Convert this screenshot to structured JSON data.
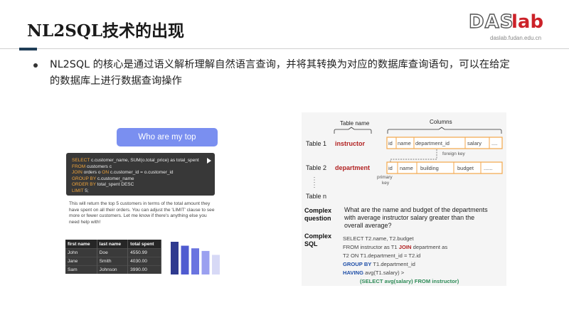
{
  "header": {
    "title": "NL2SQL技术的出现",
    "logo_das": "DAS",
    "logo_lab": "lab",
    "logo_url": "daslab.fudan.edu.cn"
  },
  "bullet": {
    "text": "NL2SQL 的核心是通过语义解析理解自然语言查询，并将其转换为对应的数据库查询语句，可以在给定的数据库上进行数据查询操作"
  },
  "chat": {
    "question": "Who are my top customers?",
    "sql_lines": [
      {
        "kw": "SELECT",
        "rest": " c.customer_name, SUM(o.total_price) as total_spent"
      },
      {
        "kw": "FROM",
        "rest": " customers c"
      },
      {
        "kw": "JOIN",
        "rest": " orders o ",
        "kw2": "ON",
        "rest2": " c.customer_id = o.customer_id"
      },
      {
        "kw": "GROUP BY",
        "rest": " c.customer_name"
      },
      {
        "kw": "ORDER BY",
        "rest": " total_spent DESC"
      },
      {
        "kw": "LIMIT",
        "rest": " 5;"
      }
    ],
    "answer": "This will return the top 5 customers in terms of the total amount they have spent on all their orders. You can adjust the 'LIMIT' clause to see more or fewer customers. Let me know if there's anything else you need help with!",
    "table": {
      "headers": [
        "first name",
        "last name",
        "total spent"
      ],
      "rows": [
        [
          "John",
          "Doe",
          "4550.99"
        ],
        [
          "Jane",
          "Smith",
          "4030.00"
        ],
        [
          "Sam",
          "Johnson",
          "3990.00"
        ]
      ]
    },
    "chart_bars": [
      {
        "value": 1.0,
        "color": "#2f3a8f"
      },
      {
        "value": 0.88,
        "color": "#4f5bd0"
      },
      {
        "value": 0.8,
        "color": "#6a74e0"
      },
      {
        "value": 0.72,
        "color": "#9aa0f0"
      },
      {
        "value": 0.6,
        "color": "#d7d9f6"
      }
    ]
  },
  "diagram": {
    "table_name_label": "Table name",
    "columns_label": "Columns",
    "table1_label": "Table 1",
    "table1_name": "instructor",
    "table1_columns": [
      "id",
      "name",
      "department_id",
      "salary",
      "...."
    ],
    "foreign_key_label": "foreign key",
    "table2_label": "Table 2",
    "table2_name": "department",
    "table2_columns": [
      "id",
      "name",
      "building",
      "budget",
      "......"
    ],
    "primary_key_label_1": "primary",
    "primary_key_label_2": "key",
    "tablen_label": "Table n",
    "complex_question_label_1": "Complex",
    "complex_question_label_2": "question",
    "complex_question_text_1": "What are the name and budget of the departments",
    "complex_question_text_2": "with average instructor salary greater than the",
    "complex_question_text_3": "overall average?",
    "complex_sql_label_1": "Complex",
    "complex_sql_label_2": "SQL",
    "sql_line1": "SELECT T2.name, T2.budget",
    "sql_line2_a": "FROM instructor as T1 ",
    "sql_line2_kw": "JOIN",
    "sql_line2_b": " department as",
    "sql_line3": "T2 ON T1.department_id = T2.id",
    "sql_line4_kw": "GROUP BY",
    "sql_line4_b": " T1.department_id",
    "sql_line5_kw": "HAVING",
    "sql_line5_b": " avg(T1.salary) >",
    "sql_line6": "(SELECT avg(salary) FROM instructor)",
    "colors": {
      "red": "#b22222",
      "blue": "#1f4fa8",
      "green": "#2e8b57",
      "orange_box": "#f3a64a"
    }
  }
}
